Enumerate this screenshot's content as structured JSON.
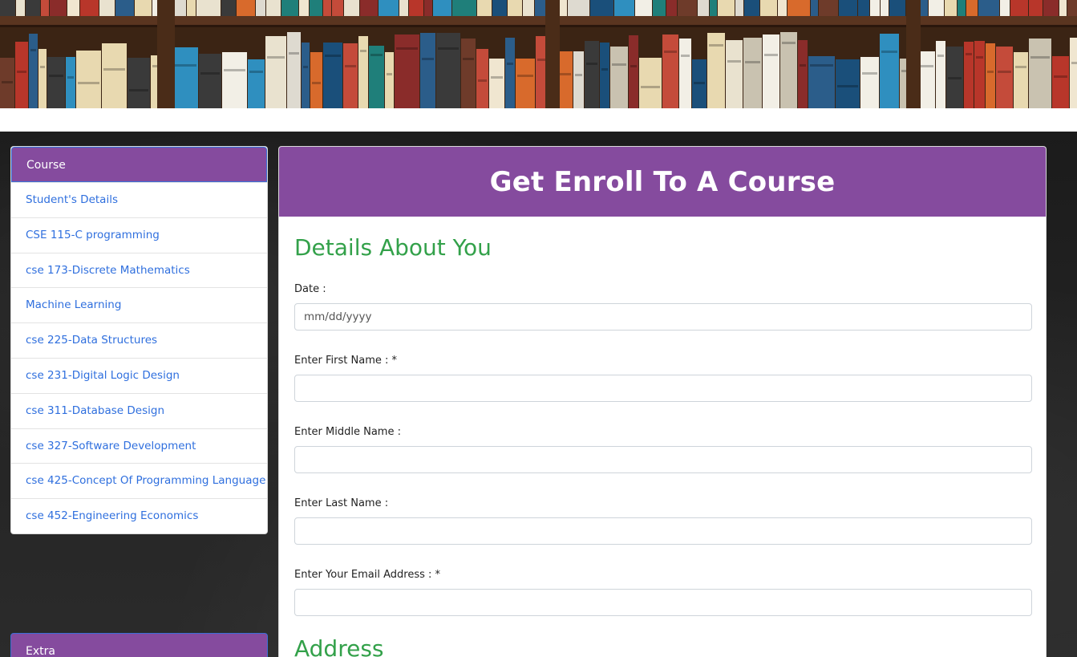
{
  "sidebar": {
    "header": "Course",
    "items": [
      {
        "label": "Student's Details"
      },
      {
        "label": "CSE 115-C programming"
      },
      {
        "label": "cse 173-Discrete Mathematics"
      },
      {
        "label": "Machine Learning"
      },
      {
        "label": "cse 225-Data Structures"
      },
      {
        "label": "cse 231-Digital Logic Design"
      },
      {
        "label": "cse 311-Database Design"
      },
      {
        "label": "cse 327-Software Development"
      },
      {
        "label": "cse 425-Concept Of Programming Language"
      },
      {
        "label": "cse 452-Engineering Economics"
      }
    ],
    "extra_header": "Extra"
  },
  "main": {
    "title": "Get Enroll To A Course",
    "section_details": "Details About You",
    "fields": {
      "date_label": "Date :",
      "date_placeholder": "mm/dd/yyyy",
      "first_name_label": "Enter First Name : *",
      "middle_name_label": "Enter Middle Name :",
      "last_name_label": "Enter Last Name :",
      "email_label": "Enter Your Email Address : *"
    },
    "section_address": "Address"
  },
  "colors": {
    "purple": "#854b9e",
    "green": "#33a14a",
    "link_blue": "#2f6fde"
  }
}
